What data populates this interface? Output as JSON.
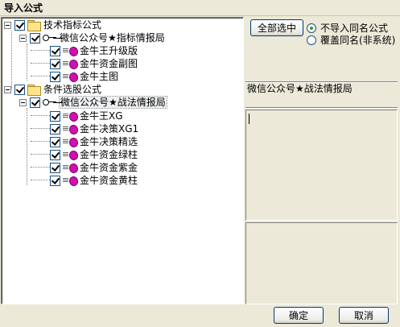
{
  "window": {
    "title": "导入公式"
  },
  "tree": {
    "groups": [
      {
        "label": "技术指标公式",
        "checked": true,
        "children": [
          {
            "label": "微信公众号★指标情报局",
            "checked": true,
            "formulas": [
              {
                "label": "金牛王升级版",
                "checked": true
              },
              {
                "label": "金牛资金副图",
                "checked": true
              },
              {
                "label": "金牛主图",
                "checked": true
              }
            ]
          }
        ]
      },
      {
        "label": "条件选股公式",
        "checked": true,
        "children": [
          {
            "label": "微信公众号★战法情报局",
            "checked": true,
            "selected": true,
            "formulas": [
              {
                "label": "金牛王XG",
                "checked": true
              },
              {
                "label": "金牛决策XG1",
                "checked": true
              },
              {
                "label": "金牛决策精选",
                "checked": true
              },
              {
                "label": "金牛资金绿柱",
                "checked": true
              },
              {
                "label": "金牛资金紫金",
                "checked": true
              },
              {
                "label": "金牛资金黄柱",
                "checked": true
              }
            ]
          }
        ]
      }
    ]
  },
  "options": {
    "select_all_label": "全部选中",
    "radio_skip_label": "不导入同名公式",
    "radio_overwrite_label": "覆盖同名(非系统)",
    "selected_radio": "skip"
  },
  "detail": {
    "group_name": "微信公众号★战法情报局",
    "description_value": "",
    "notes_value": ""
  },
  "footer": {
    "ok_label": "确定",
    "cancel_label": "取消"
  },
  "colors": {
    "window_bg": "#ece9d8",
    "formula_icon": "#d010b0",
    "radio_dot": "#21a121",
    "button_border": "#003c74"
  }
}
